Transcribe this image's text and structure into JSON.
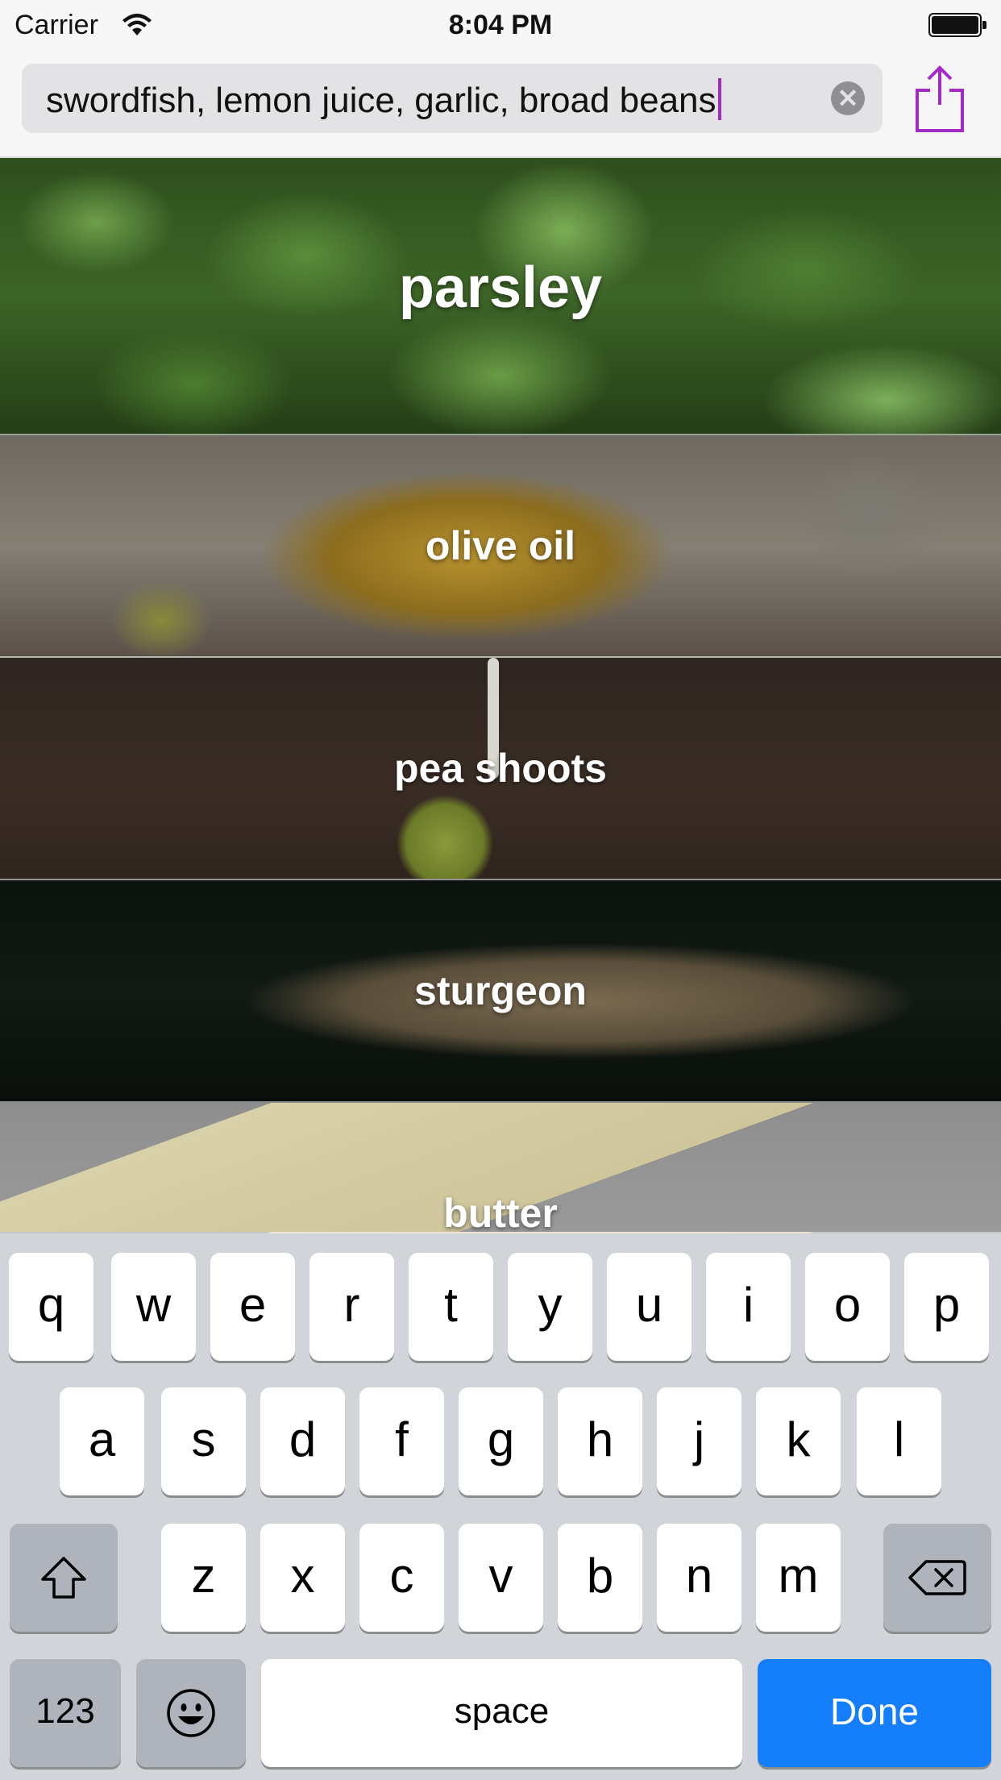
{
  "status_bar": {
    "carrier": "Carrier",
    "time": "8:04 PM",
    "wifi_icon": "wifi-icon",
    "battery_icon": "battery-icon"
  },
  "search": {
    "value": "swordfish, lemon juice, garlic, broad beans",
    "clear_icon": "clear-icon",
    "clear_glyph": "✕",
    "share_icon": "share-icon",
    "accent_color": "#a42cc4"
  },
  "ingredients": [
    {
      "name": "parsley"
    },
    {
      "name": "olive oil"
    },
    {
      "name": "pea shoots"
    },
    {
      "name": "sturgeon"
    },
    {
      "name": "butter"
    }
  ],
  "keyboard": {
    "row1": [
      "q",
      "w",
      "e",
      "r",
      "t",
      "y",
      "u",
      "i",
      "o",
      "p"
    ],
    "row2": [
      "a",
      "s",
      "d",
      "f",
      "g",
      "h",
      "j",
      "k",
      "l"
    ],
    "row3": [
      "z",
      "x",
      "c",
      "v",
      "b",
      "n",
      "m"
    ],
    "numbers_label": "123",
    "space_label": "space",
    "done_label": "Done",
    "done_color": "#147efb",
    "shift_icon": "shift-icon",
    "delete_icon": "delete-icon",
    "emoji_icon": "emoji-icon"
  }
}
